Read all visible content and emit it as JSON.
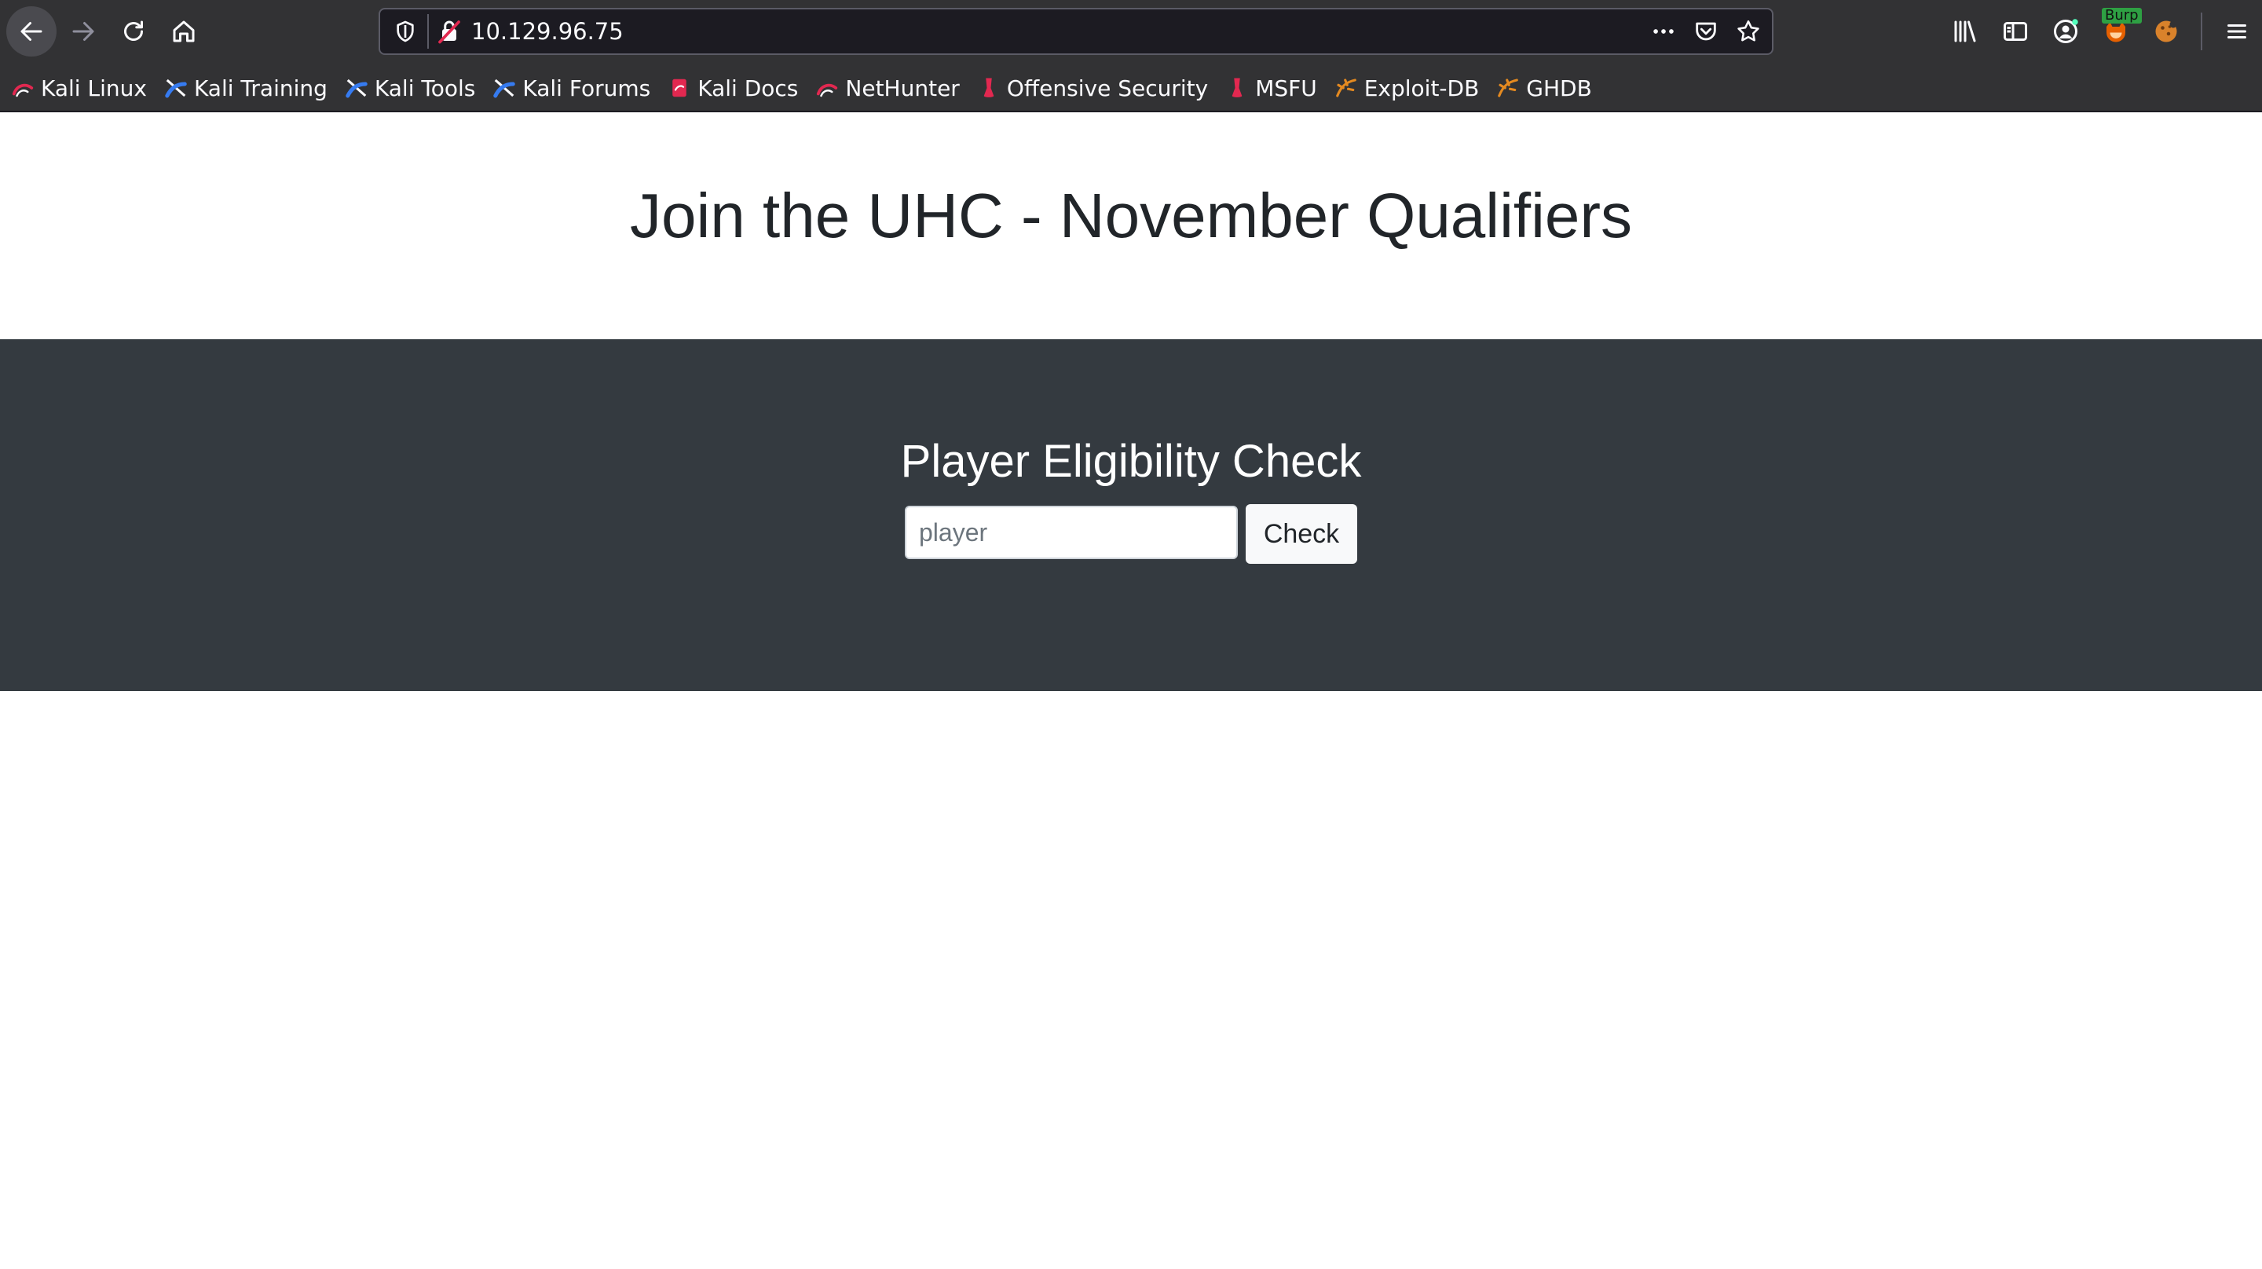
{
  "browser": {
    "url": "10.129.96.75",
    "burp_badge": "Burp",
    "bookmarks": [
      {
        "label": "Kali Linux",
        "icon": "kali-linux-icon"
      },
      {
        "label": "Kali Training",
        "icon": "kali-training-icon"
      },
      {
        "label": "Kali Tools",
        "icon": "kali-tools-icon"
      },
      {
        "label": "Kali Forums",
        "icon": "kali-forums-icon"
      },
      {
        "label": "Kali Docs",
        "icon": "kali-docs-icon"
      },
      {
        "label": "NetHunter",
        "icon": "nethunter-icon"
      },
      {
        "label": "Offensive Security",
        "icon": "offsec-icon"
      },
      {
        "label": "MSFU",
        "icon": "msfu-icon"
      },
      {
        "label": "Exploit-DB",
        "icon": "exploitdb-icon"
      },
      {
        "label": "GHDB",
        "icon": "ghdb-icon"
      }
    ]
  },
  "page": {
    "title": "Join the UHC - November Qualifiers",
    "section_title": "Player Eligibility Check",
    "input_placeholder": "player",
    "input_value": "",
    "button_label": "Check"
  },
  "colors": {
    "chrome_bg": "#323234",
    "urlbar_bg": "#1c1b22",
    "band_bg": "#343a40",
    "title_text": "#212529",
    "burp_badge": "#2ea043"
  }
}
